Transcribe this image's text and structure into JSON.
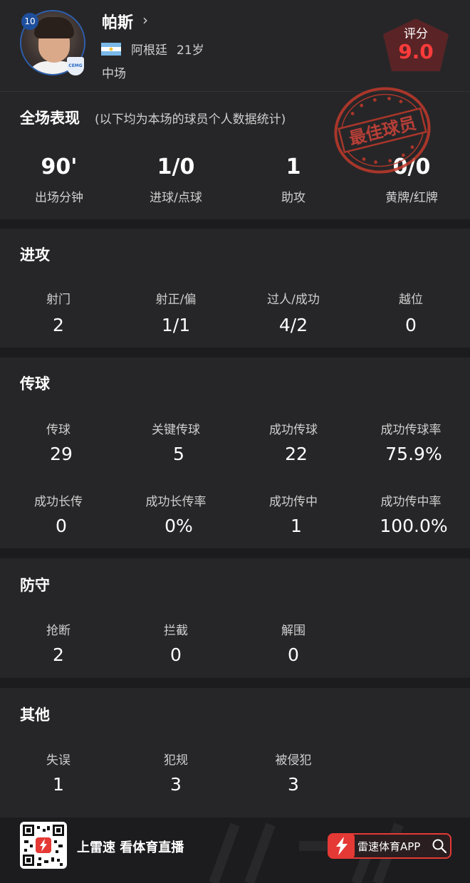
{
  "header": {
    "jersey_number": "10",
    "club_badge": "CEMG",
    "player_name": "帕斯",
    "chevron": "›",
    "country": "阿根廷",
    "age": "21岁",
    "position": "中场",
    "rating_label": "评分",
    "rating_value": "9.0"
  },
  "overview": {
    "title": "全场表现",
    "subtitle": "(以下均为本场的球员个人数据统计)",
    "stamp_text": "最佳球员",
    "stats": [
      {
        "value": "90'",
        "label": "出场分钟"
      },
      {
        "value": "1/0",
        "label": "进球/点球"
      },
      {
        "value": "1",
        "label": "助攻"
      },
      {
        "value": "0/0",
        "label": "黄牌/红牌"
      }
    ]
  },
  "attack": {
    "title": "进攻",
    "stats": [
      {
        "label": "射门",
        "value": "2"
      },
      {
        "label": "射正/偏",
        "value": "1/1"
      },
      {
        "label": "过人/成功",
        "value": "4/2"
      },
      {
        "label": "越位",
        "value": "0"
      }
    ]
  },
  "passing": {
    "title": "传球",
    "stats": [
      {
        "label": "传球",
        "value": "29"
      },
      {
        "label": "关键传球",
        "value": "5"
      },
      {
        "label": "成功传球",
        "value": "22"
      },
      {
        "label": "成功传球率",
        "value": "75.9%"
      },
      {
        "label": "成功长传",
        "value": "0"
      },
      {
        "label": "成功长传率",
        "value": "0%"
      },
      {
        "label": "成功传中",
        "value": "1"
      },
      {
        "label": "成功传中率",
        "value": "100.0%"
      }
    ]
  },
  "defense": {
    "title": "防守",
    "stats": [
      {
        "label": "抢断",
        "value": "2"
      },
      {
        "label": "拦截",
        "value": "0"
      },
      {
        "label": "解围",
        "value": "0"
      }
    ]
  },
  "other": {
    "title": "其他",
    "stats": [
      {
        "label": "失误",
        "value": "1"
      },
      {
        "label": "犯规",
        "value": "3"
      },
      {
        "label": "被侵犯",
        "value": "3"
      }
    ]
  },
  "footer": {
    "slogan": "上雷速 看体育直播",
    "app_name": "雷速体育APP"
  },
  "colors": {
    "accent_red": "#e53935",
    "rating_red": "#ff3b3b",
    "card_bg": "#262628",
    "page_bg": "#1c1c1e"
  },
  "icons": [
    "chevron-right-icon",
    "argentina-flag-icon",
    "club-badge-icon",
    "best-player-stamp-icon",
    "qr-code-icon",
    "lightning-icon",
    "search-icon"
  ]
}
